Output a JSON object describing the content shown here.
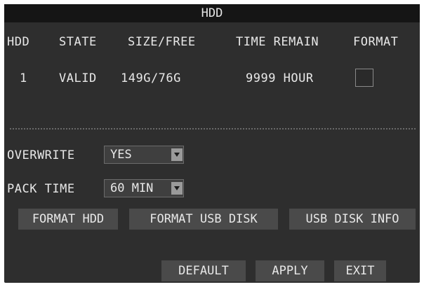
{
  "title": "HDD",
  "columns": [
    "HDD",
    "STATE",
    "SIZE/FREE",
    "TIME REMAIN",
    "FORMAT"
  ],
  "rows": [
    {
      "hdd": "1",
      "state": "VALID",
      "size_free": "149G/76G",
      "time_remain": "9999 HOUR",
      "format_checked": false
    }
  ],
  "overwrite": {
    "label": "OVERWRITE",
    "value": "YES"
  },
  "pack_time": {
    "label": "PACK TIME",
    "value": "60 MIN"
  },
  "buttons": {
    "format_hdd": "FORMAT HDD",
    "format_usb": "FORMAT USB DISK",
    "usb_info": "USB DISK INFO"
  },
  "footer": {
    "default": "DEFAULT",
    "apply": "APPLY",
    "exit": "EXIT"
  }
}
